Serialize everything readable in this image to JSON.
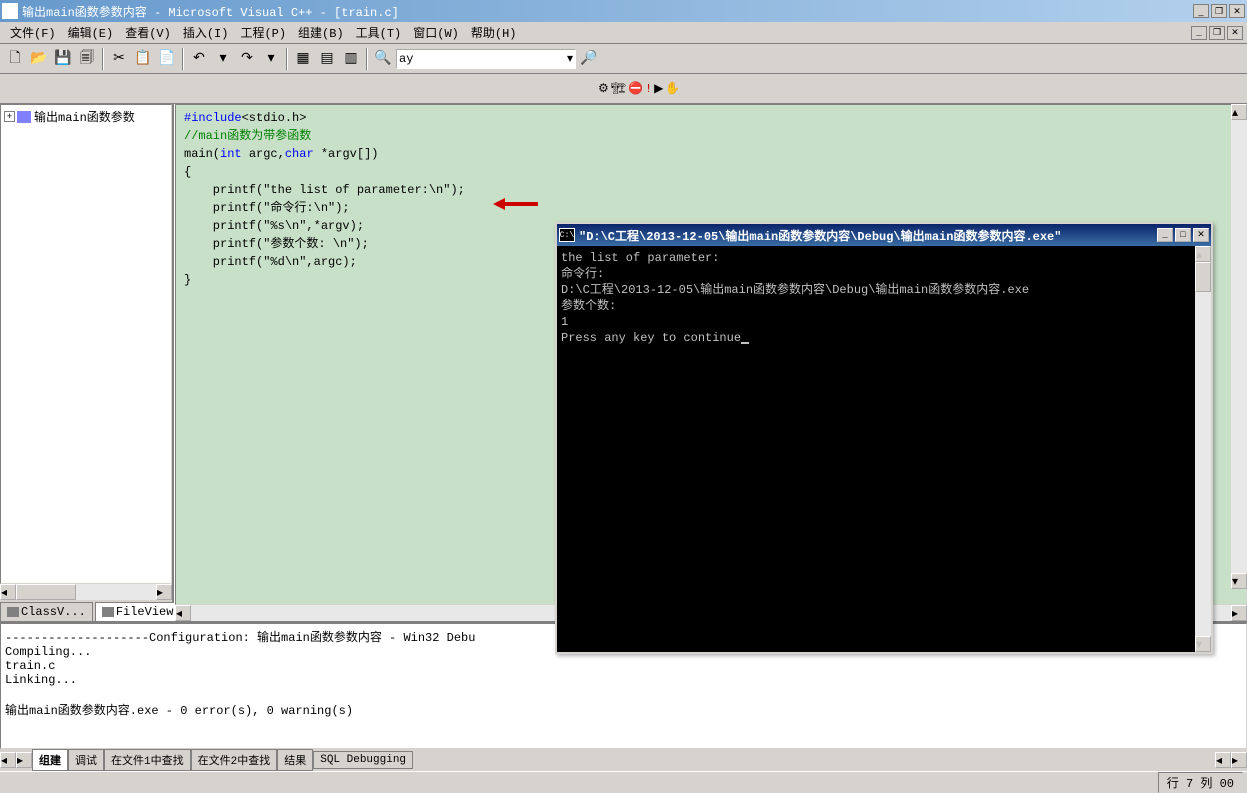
{
  "titlebar": {
    "title": "输出main函数参数内容 - Microsoft Visual C++ - [train.c]"
  },
  "menu": {
    "items": [
      "文件(F)",
      "编辑(E)",
      "查看(V)",
      "插入(I)",
      "工程(P)",
      "组建(B)",
      "工具(T)",
      "窗口(W)",
      "帮助(H)"
    ]
  },
  "toolbar": {
    "combo_value": "ay"
  },
  "tree": {
    "root": "输出main函数参数"
  },
  "sidebar_tabs": {
    "classview": "ClassV...",
    "fileview": "FileView"
  },
  "code": {
    "line1_a": "#include",
    "line1_b": "<stdio.h>",
    "line2": "//main函数为带参函数",
    "line3_a": "main(",
    "line3_b": "int",
    "line3_c": " argc,",
    "line3_d": "char",
    "line3_e": " *argv[])",
    "line4": "{",
    "line5": "    printf(\"the list of parameter:\\n\");",
    "line6": "    printf(\"命令行:\\n\");",
    "line7": "    printf(\"%s\\n\",*argv);",
    "line8": "    printf(\"参数个数: \\n\");",
    "line9": "    printf(\"%d\\n\",argc);",
    "line10": "}"
  },
  "output": {
    "text": "--------------------Configuration: 输出main函数参数内容 - Win32 Debu\nCompiling...\ntrain.c\nLinking...\n\n输出main函数参数内容.exe - 0 error(s), 0 warning(s)",
    "tabs": [
      "组建",
      "调试",
      "在文件1中查找",
      "在文件2中查找",
      "结果",
      "SQL Debugging"
    ]
  },
  "status": {
    "pos": "行 7 列 00"
  },
  "console": {
    "title": "\"D:\\C工程\\2013-12-05\\输出main函数参数内容\\Debug\\输出main函数参数内容.exe\"",
    "cicon": "C:\\",
    "body": "the list of parameter:\n命令行:\nD:\\C工程\\2013-12-05\\输出main函数参数内容\\Debug\\输出main函数参数内容.exe\n参数个数:\n1\nPress any key to continue"
  }
}
